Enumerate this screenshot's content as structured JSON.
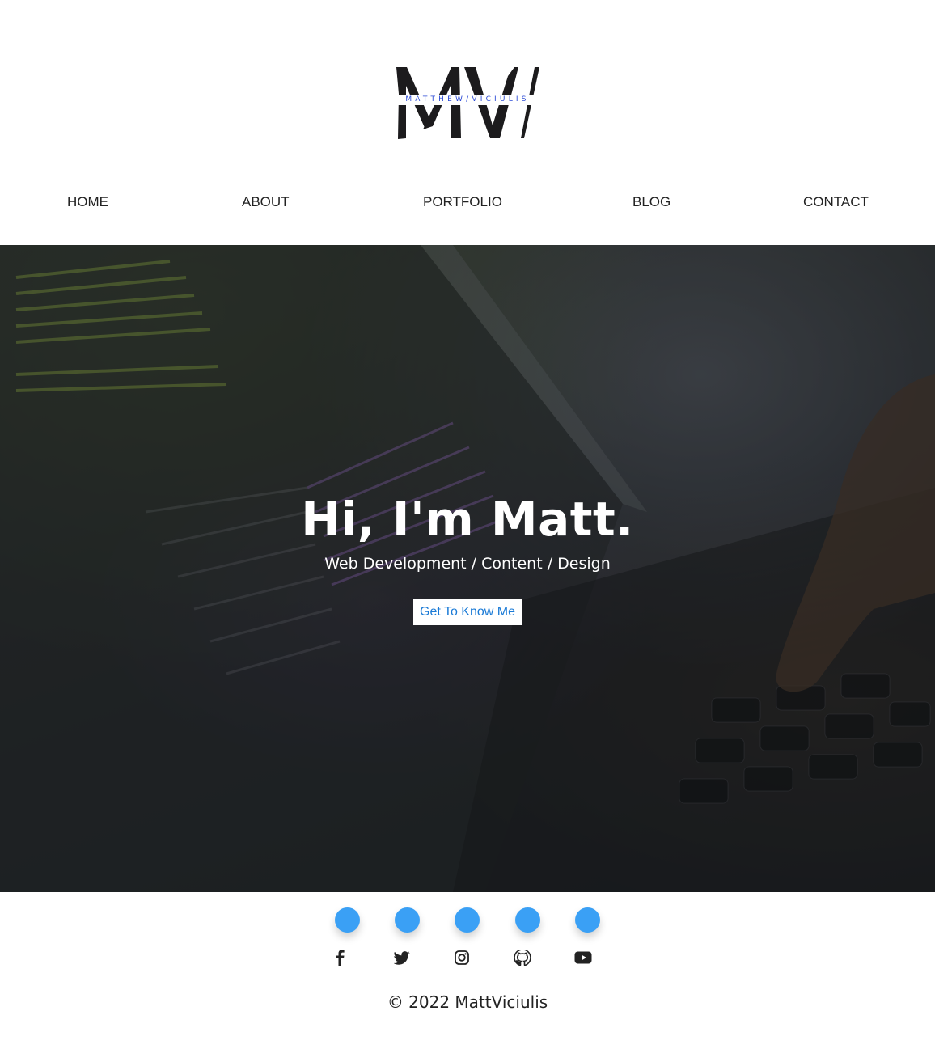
{
  "brand": {
    "monogram": "MV",
    "name": "MATTHEW/VICIULIS",
    "colors": {
      "logo_dark": "#1c1b1d",
      "logo_text": "#2c4bd6"
    }
  },
  "nav": [
    {
      "label": "HOME"
    },
    {
      "label": "ABOUT"
    },
    {
      "label": "PORTFOLIO"
    },
    {
      "label": "BLOG"
    },
    {
      "label": "CONTACT"
    }
  ],
  "hero": {
    "title": "Hi, I'm Matt.",
    "subtitle": "Web Development / Content / Design",
    "button_label": "Get To Know Me",
    "button_text_color": "#1a7ad6"
  },
  "decorations": {
    "dot_color": "#3aa0f5",
    "dot_count": 5
  },
  "social": [
    {
      "icon": "facebook-icon"
    },
    {
      "icon": "twitter-icon"
    },
    {
      "icon": "instagram-icon"
    },
    {
      "icon": "github-icon"
    },
    {
      "icon": "youtube-icon"
    }
  ],
  "footer": {
    "copyright": "© 2022 MattViciulis"
  }
}
